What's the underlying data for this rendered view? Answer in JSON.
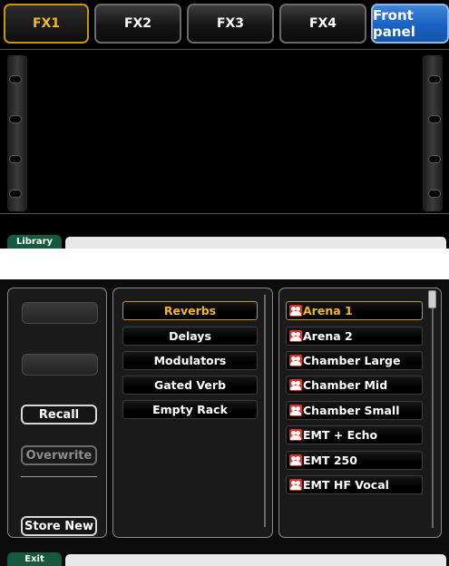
{
  "top_tabs": [
    {
      "label": "FX1",
      "state": "active"
    },
    {
      "label": "FX2",
      "state": "normal"
    },
    {
      "label": "FX3",
      "state": "normal"
    },
    {
      "label": "FX4",
      "state": "normal"
    },
    {
      "label": "Front panel",
      "state": "highlight"
    }
  ],
  "top_bar": {
    "tab_label": "Library"
  },
  "library": {
    "left_buttons": {
      "recall": "Recall",
      "overwrite": "Overwrite",
      "store_new": "Store New"
    },
    "categories": [
      "Reverbs",
      "Delays",
      "Modulators",
      "Gated Verb",
      "Empty Rack"
    ],
    "selected_category": "Reverbs",
    "presets": [
      "Arena 1",
      "Arena 2",
      "Chamber Large",
      "Chamber Mid",
      "Chamber Small",
      "EMT + Echo",
      "EMT 250",
      "EMT HF Vocal"
    ],
    "selected_preset": "Arena 1"
  },
  "bottom_bar": {
    "tab_label": "Exit"
  },
  "colors": {
    "accent_gold": "#f3b81b",
    "tab_blue": "#1a62c2",
    "bar_green": "#155a40",
    "preset_icon_red": "#d9312b"
  }
}
